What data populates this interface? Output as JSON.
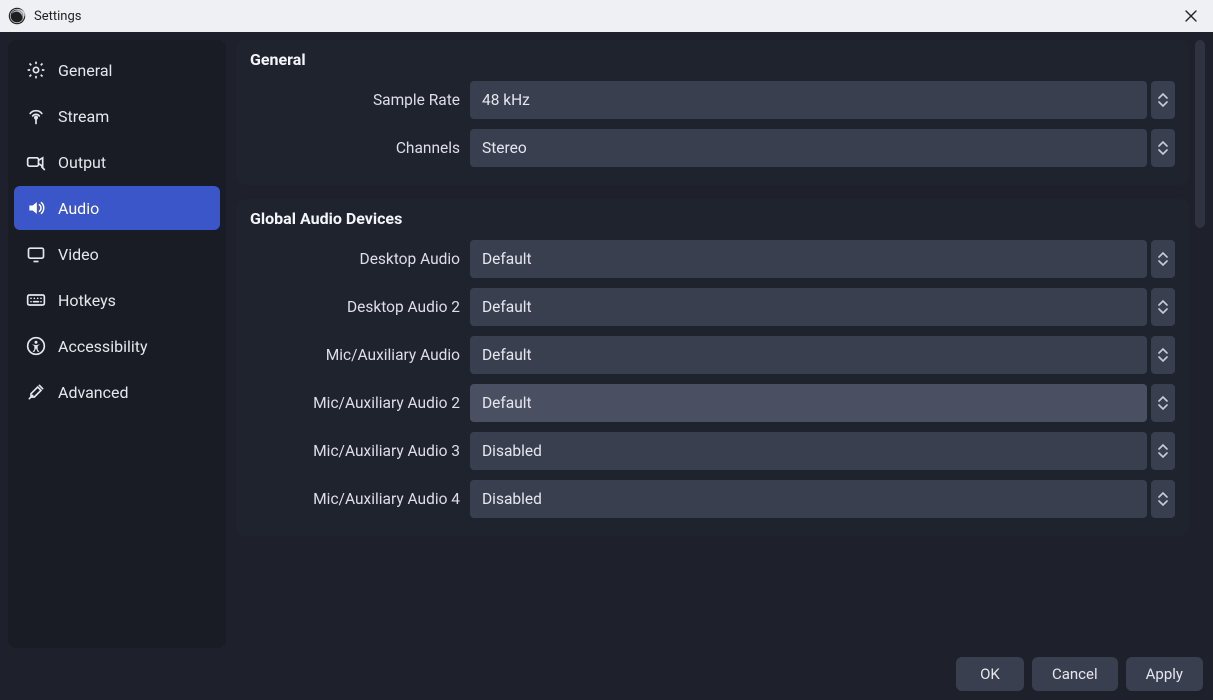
{
  "titlebar": {
    "title": "Settings"
  },
  "sidebar": {
    "items": [
      {
        "id": "general",
        "label": "General",
        "icon": "gear-icon",
        "selected": false
      },
      {
        "id": "stream",
        "label": "Stream",
        "icon": "antenna-icon",
        "selected": false
      },
      {
        "id": "output",
        "label": "Output",
        "icon": "camera-export-icon",
        "selected": false
      },
      {
        "id": "audio",
        "label": "Audio",
        "icon": "speaker-icon",
        "selected": true
      },
      {
        "id": "video",
        "label": "Video",
        "icon": "monitor-icon",
        "selected": false
      },
      {
        "id": "hotkeys",
        "label": "Hotkeys",
        "icon": "keyboard-icon",
        "selected": false
      },
      {
        "id": "accessibility",
        "label": "Accessibility",
        "icon": "accessibility-icon",
        "selected": false
      },
      {
        "id": "advanced",
        "label": "Advanced",
        "icon": "tools-icon",
        "selected": false
      }
    ]
  },
  "sections": {
    "general": {
      "title": "General",
      "rows": [
        {
          "id": "sample-rate",
          "label": "Sample Rate",
          "value": "48 kHz"
        },
        {
          "id": "channels",
          "label": "Channels",
          "value": "Stereo"
        }
      ]
    },
    "devices": {
      "title": "Global Audio Devices",
      "rows": [
        {
          "id": "desktop-audio",
          "label": "Desktop Audio",
          "value": "Default"
        },
        {
          "id": "desktop-audio-2",
          "label": "Desktop Audio 2",
          "value": "Default"
        },
        {
          "id": "mic-aux-audio",
          "label": "Mic/Auxiliary Audio",
          "value": "Default"
        },
        {
          "id": "mic-aux-audio-2",
          "label": "Mic/Auxiliary Audio 2",
          "value": "Default",
          "hover": true
        },
        {
          "id": "mic-aux-audio-3",
          "label": "Mic/Auxiliary Audio 3",
          "value": "Disabled"
        },
        {
          "id": "mic-aux-audio-4",
          "label": "Mic/Auxiliary Audio 4",
          "value": "Disabled"
        }
      ]
    }
  },
  "footer": {
    "ok": "OK",
    "cancel": "Cancel",
    "apply": "Apply"
  }
}
